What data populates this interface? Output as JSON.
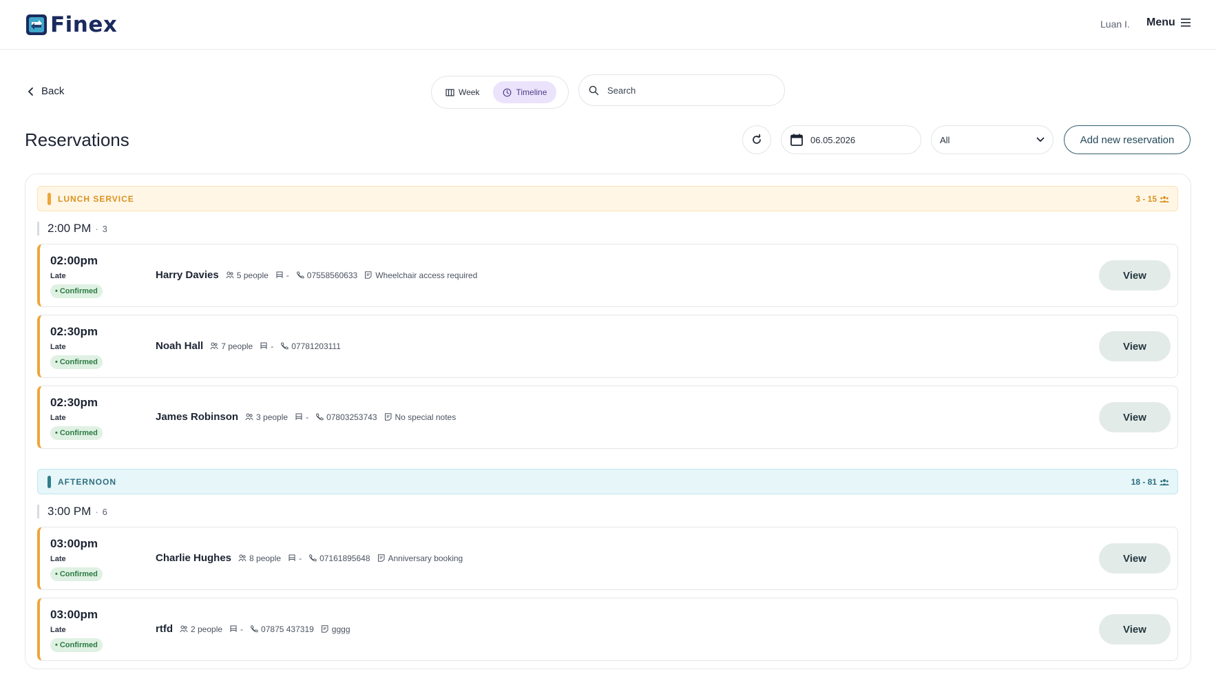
{
  "header": {
    "logo_text": "Finex",
    "user_name": "Luan I.",
    "menu_label": "Menu"
  },
  "toolbar": {
    "back_label": "Back",
    "views": [
      {
        "label": "Week",
        "icon": "grid-icon",
        "active": false
      },
      {
        "label": "Timeline",
        "icon": "clock-icon",
        "active": true
      }
    ],
    "search_placeholder": "Search",
    "title": "Reservations",
    "date_value": "06.05.2026",
    "filter_value": "All",
    "add_label": "Add new reservation"
  },
  "colors": {
    "accent_orange": "#eea53a",
    "lunch_text": "#d9921e",
    "afternoon_text": "#2f6f80",
    "confirmed_bg": "#dff1e3",
    "confirmed_text": "#2c7a44",
    "toggle_active": "#ebe3fb"
  },
  "services": [
    {
      "name": "LUNCH SERVICE",
      "count": "3 - 15",
      "slots": [
        {
          "time": "2:00 PM",
          "count": "3",
          "reservations": [
            {
              "slot": "02:00pm",
              "late": "Late",
              "status": "Confirmed",
              "guest": "Harry Davies",
              "people": "5 people",
              "table": "-",
              "phone": "07558560633",
              "note": "Wheelchair access required",
              "view": "View"
            },
            {
              "slot": "02:30pm",
              "late": "Late",
              "status": "Confirmed",
              "guest": "Noah Hall",
              "people": "7 people",
              "table": "-",
              "phone": "07781203111",
              "note": "",
              "view": "View"
            },
            {
              "slot": "02:30pm",
              "late": "Late",
              "status": "Confirmed",
              "guest": "James Robinson",
              "people": "3 people",
              "table": "-",
              "phone": "07803253743",
              "note": "No special notes",
              "view": "View"
            }
          ]
        }
      ]
    },
    {
      "name": "AFTERNOON",
      "count": "18 - 81",
      "slots": [
        {
          "time": "3:00 PM",
          "count": "6",
          "reservations": [
            {
              "slot": "03:00pm",
              "late": "Late",
              "status": "Confirmed",
              "guest": "Charlie Hughes",
              "people": "8 people",
              "table": "-",
              "phone": "07161895648",
              "note": "Anniversary booking",
              "view": "View"
            },
            {
              "slot": "03:00pm",
              "late": "Late",
              "status": "Confirmed",
              "guest": "rtfd",
              "people": "2 people",
              "table": "-",
              "phone": "07875 437319",
              "note": "gggg",
              "view": "View"
            }
          ]
        }
      ]
    }
  ]
}
